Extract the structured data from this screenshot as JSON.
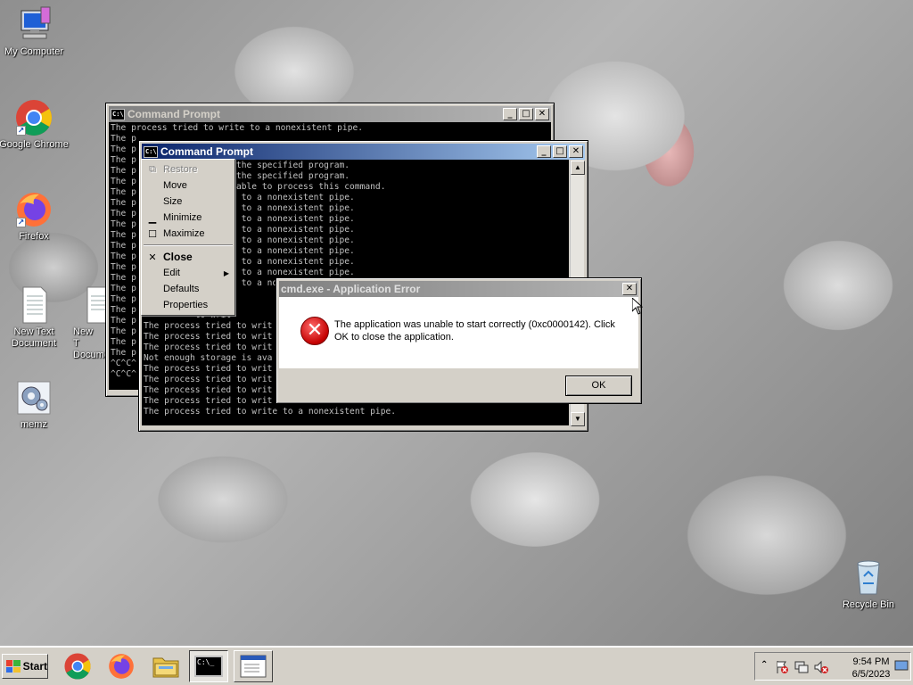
{
  "desktop": {
    "icons": [
      {
        "label": "My Computer",
        "icon": "computer-icon"
      },
      {
        "label": "Google Chrome",
        "icon": "chrome-icon"
      },
      {
        "label": "Firefox",
        "icon": "firefox-icon"
      },
      {
        "label": "New Text Document",
        "icon": "text-document-icon"
      },
      {
        "label": "New T Docume",
        "icon": "text-document-icon"
      },
      {
        "label": "memz",
        "icon": "gear-icon"
      },
      {
        "label": "Recycle Bin",
        "icon": "recycle-bin-icon"
      }
    ]
  },
  "cmd_back": {
    "title": "Command Prompt",
    "lines": [
      "The process tried to write to a nonexistent pipe.",
      "The p",
      "The p",
      "The p",
      "The p",
      "The p",
      "The p",
      "The p",
      "The p",
      "The p",
      "The p",
      "The p",
      "The p",
      "The p",
      "The p",
      "The p",
      "The p",
      "The p",
      "The p",
      "The p",
      "The p",
      "The p",
      "^C^C^",
      "^C^C^"
    ]
  },
  "cmd_front": {
    "title": "Command Prompt",
    "lines": [
      "          execute the specified program.",
      "          execute the specified program.",
      "          is available to process this command.",
      "          to write to a nonexistent pipe.",
      "          to write to a nonexistent pipe.",
      "          to write to a nonexistent pipe.",
      "          to write to a nonexistent pipe.",
      "          to write to a nonexistent pipe.",
      "          to write to a nonexistent pipe.",
      "          to write to a nonexistent pipe.",
      "          to write to a nonexistent pipe.",
      "          to write to a nonexistent pipe.",
      "          to writ",
      "          to writ",
      "          to writ",
      "The process tried to writ",
      "The process tried to writ",
      "The process tried to writ",
      "Not enough storage is ava",
      "The process tried to writ",
      "The process tried to writ",
      "The process tried to writ",
      "The process tried to writ",
      "The process tried to write to a nonexistent pipe."
    ]
  },
  "system_menu": {
    "items": [
      {
        "label": "Restore",
        "icon": "restore-icon",
        "disabled": true
      },
      {
        "label": "Move",
        "icon": "",
        "disabled": false
      },
      {
        "label": "Size",
        "icon": "",
        "disabled": false
      },
      {
        "label": "Minimize",
        "icon": "minimize-icon",
        "disabled": false
      },
      {
        "label": "Maximize",
        "icon": "maximize-icon",
        "disabled": false
      },
      {
        "label": "Close",
        "icon": "close-icon",
        "disabled": false
      },
      {
        "label": "Edit",
        "icon": "",
        "disabled": false
      },
      {
        "label": "Defaults",
        "icon": "",
        "disabled": false
      },
      {
        "label": "Properties",
        "icon": "",
        "disabled": false
      }
    ]
  },
  "error_dialog": {
    "title": "cmd.exe - Application Error",
    "message": "The application was unable to start correctly (0xc0000142). Click OK to close the application.",
    "ok_label": "OK"
  },
  "taskbar": {
    "start_label": "Start",
    "buttons": [
      "chrome-icon",
      "firefox-icon",
      "file-explorer-icon",
      "command-prompt-icon",
      "window-icon"
    ],
    "tray_icons": [
      "chevron-up-icon",
      "action-center-icon",
      "network-icon",
      "volume-icon",
      "show-desktop-icon"
    ],
    "clock_time": "9:54 PM",
    "clock_date": "6/5/2023"
  }
}
